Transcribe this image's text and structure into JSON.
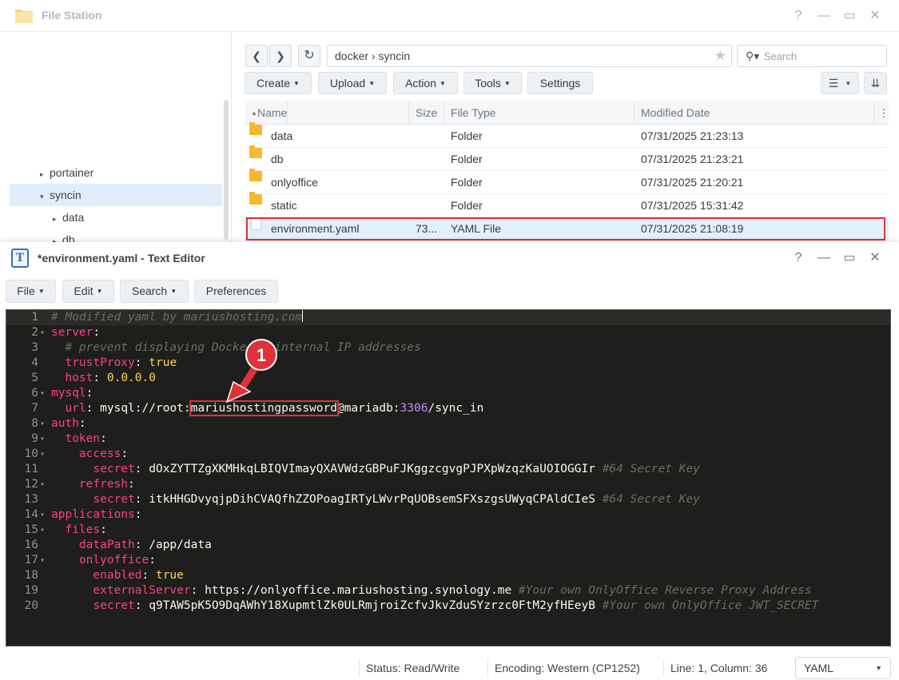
{
  "file_station": {
    "title": "File Station",
    "window_controls": [
      "?",
      "—",
      "▭",
      "✕"
    ],
    "tree": [
      {
        "label": "portainer",
        "arrow": "▸"
      },
      {
        "label": "syncin",
        "arrow": "▾",
        "selected": true
      },
      {
        "label": "data",
        "arrow": "▸"
      },
      {
        "label": "db",
        "arrow": "▸"
      }
    ],
    "nav": {
      "back": "❮",
      "forward": "❯",
      "refresh": "↻"
    },
    "path": {
      "parts": [
        "docker",
        "syncin"
      ],
      "separator": "›",
      "text": "docker › syncin"
    },
    "search_placeholder": "Search",
    "toolbar": {
      "create": "Create",
      "upload": "Upload",
      "action": "Action",
      "tools": "Tools",
      "settings": "Settings"
    },
    "columns": [
      "Name",
      "Size",
      "File Type",
      "Modified Date"
    ],
    "sort_indicator": "▲",
    "rows": [
      {
        "name": "data",
        "size": "",
        "type": "Folder",
        "modified": "07/31/2025 21:23:13",
        "icon": "folder-icon"
      },
      {
        "name": "db",
        "size": "",
        "type": "Folder",
        "modified": "07/31/2025 21:23:21",
        "icon": "folder-icon"
      },
      {
        "name": "onlyoffice",
        "size": "",
        "type": "Folder",
        "modified": "07/31/2025 21:20:21",
        "icon": "folder-icon"
      },
      {
        "name": "static",
        "size": "",
        "type": "Folder",
        "modified": "07/31/2025 15:31:42",
        "icon": "folder-icon"
      },
      {
        "name": "environment.yaml",
        "size": "73...",
        "type": "YAML File",
        "modified": "07/31/2025 21:08:19",
        "icon": "file-icon",
        "selected": true
      }
    ]
  },
  "text_editor": {
    "title": "*environment.yaml - Text Editor",
    "menus": {
      "file": "File",
      "edit": "Edit",
      "search": "Search",
      "preferences": "Preferences"
    },
    "annotation_number": "1",
    "lines": [
      {
        "n": "1",
        "fold": "",
        "segs": [
          {
            "t": "# Modified yaml by mariushosting.com",
            "c": "comment"
          }
        ]
      },
      {
        "n": "2",
        "fold": "▾",
        "segs": [
          {
            "t": "server",
            "c": "key"
          },
          {
            "t": ":",
            "c": "punct"
          }
        ]
      },
      {
        "n": "3",
        "fold": "",
        "segs": [
          {
            "t": "  ",
            "c": "plain"
          },
          {
            "t": "# prevent displaying Docker's internal IP addresses",
            "c": "comment"
          }
        ]
      },
      {
        "n": "4",
        "fold": "",
        "segs": [
          {
            "t": "  ",
            "c": "plain"
          },
          {
            "t": "trustProxy",
            "c": "key"
          },
          {
            "t": ": ",
            "c": "punct"
          },
          {
            "t": "true",
            "c": "bool"
          }
        ]
      },
      {
        "n": "5",
        "fold": "",
        "segs": [
          {
            "t": "  ",
            "c": "plain"
          },
          {
            "t": "host",
            "c": "key"
          },
          {
            "t": ": ",
            "c": "punct"
          },
          {
            "t": "0.0.0.0",
            "c": "bool"
          }
        ]
      },
      {
        "n": "6",
        "fold": "▾",
        "segs": [
          {
            "t": "mysql",
            "c": "key"
          },
          {
            "t": ":",
            "c": "punct"
          }
        ]
      },
      {
        "n": "7",
        "fold": "",
        "segs": [
          {
            "t": "  ",
            "c": "plain"
          },
          {
            "t": "url",
            "c": "key"
          },
          {
            "t": ": ",
            "c": "punct"
          },
          {
            "t": "mysql://root:",
            "c": "plain"
          },
          {
            "t": "mariushostingpassword",
            "c": "password"
          },
          {
            "t": "@mariadb:",
            "c": "plain"
          },
          {
            "t": "3306",
            "c": "num"
          },
          {
            "t": "/sync_in",
            "c": "plain"
          }
        ]
      },
      {
        "n": "8",
        "fold": "▾",
        "segs": [
          {
            "t": "auth",
            "c": "key"
          },
          {
            "t": ":",
            "c": "punct"
          }
        ]
      },
      {
        "n": "9",
        "fold": "▾",
        "segs": [
          {
            "t": "  ",
            "c": "plain"
          },
          {
            "t": "token",
            "c": "key"
          },
          {
            "t": ":",
            "c": "punct"
          }
        ]
      },
      {
        "n": "10",
        "fold": "▾",
        "segs": [
          {
            "t": "    ",
            "c": "plain"
          },
          {
            "t": "access",
            "c": "key"
          },
          {
            "t": ":",
            "c": "punct"
          }
        ]
      },
      {
        "n": "11",
        "fold": "",
        "segs": [
          {
            "t": "      ",
            "c": "plain"
          },
          {
            "t": "secret",
            "c": "key"
          },
          {
            "t": ": ",
            "c": "punct"
          },
          {
            "t": "dOxZYTTZgXKMHkqLBIQVImayQXAVWdzGBPuFJKggzcgvgPJPXpWzqzKaUOIOGGIr ",
            "c": "plain"
          },
          {
            "t": "#64 Secret Key",
            "c": "comment"
          }
        ]
      },
      {
        "n": "12",
        "fold": "▾",
        "segs": [
          {
            "t": "    ",
            "c": "plain"
          },
          {
            "t": "refresh",
            "c": "key"
          },
          {
            "t": ":",
            "c": "punct"
          }
        ]
      },
      {
        "n": "13",
        "fold": "",
        "segs": [
          {
            "t": "      ",
            "c": "plain"
          },
          {
            "t": "secret",
            "c": "key"
          },
          {
            "t": ": ",
            "c": "punct"
          },
          {
            "t": "itkHHGDvyqjpDihCVAQfhZZOPoagIRTyLWvrPqUOBsemSFXszgsUWyqCPAldCIeS ",
            "c": "plain"
          },
          {
            "t": "#64 Secret Key",
            "c": "comment"
          }
        ]
      },
      {
        "n": "14",
        "fold": "▾",
        "segs": [
          {
            "t": "applications",
            "c": "key"
          },
          {
            "t": ":",
            "c": "punct"
          }
        ]
      },
      {
        "n": "15",
        "fold": "▾",
        "segs": [
          {
            "t": "  ",
            "c": "plain"
          },
          {
            "t": "files",
            "c": "key"
          },
          {
            "t": ":",
            "c": "punct"
          }
        ]
      },
      {
        "n": "16",
        "fold": "",
        "segs": [
          {
            "t": "    ",
            "c": "plain"
          },
          {
            "t": "dataPath",
            "c": "key"
          },
          {
            "t": ": ",
            "c": "punct"
          },
          {
            "t": "/app/data",
            "c": "plain"
          }
        ]
      },
      {
        "n": "17",
        "fold": "▾",
        "segs": [
          {
            "t": "    ",
            "c": "plain"
          },
          {
            "t": "onlyoffice",
            "c": "key"
          },
          {
            "t": ":",
            "c": "punct"
          }
        ]
      },
      {
        "n": "18",
        "fold": "",
        "segs": [
          {
            "t": "      ",
            "c": "plain"
          },
          {
            "t": "enabled",
            "c": "key"
          },
          {
            "t": ": ",
            "c": "punct"
          },
          {
            "t": "true",
            "c": "bool"
          }
        ]
      },
      {
        "n": "19",
        "fold": "",
        "segs": [
          {
            "t": "      ",
            "c": "plain"
          },
          {
            "t": "externalServer",
            "c": "key"
          },
          {
            "t": ": ",
            "c": "punct"
          },
          {
            "t": "https://onlyoffice.mariushosting.synology.me ",
            "c": "plain"
          },
          {
            "t": "#Your own OnlyOffice Reverse Proxy Address",
            "c": "comment"
          }
        ]
      },
      {
        "n": "20",
        "fold": "",
        "segs": [
          {
            "t": "      ",
            "c": "plain"
          },
          {
            "t": "secret",
            "c": "key"
          },
          {
            "t": ": ",
            "c": "punct"
          },
          {
            "t": "q9TAW5pK5O9DqAWhY18XupmtlZk0ULRmjroiZcfvJkvZduSYzrzc0FtM2yfHEeyB ",
            "c": "plain"
          },
          {
            "t": "#Your own OnlyOffice JWT_SECRET",
            "c": "comment"
          }
        ]
      }
    ],
    "status": {
      "mode": "Status: Read/Write",
      "encoding": "Encoding: Western (CP1252)",
      "position": "Line: 1, Column: 36",
      "language": "YAML"
    }
  },
  "colors": {
    "editor_bg": "#1e1f1c",
    "key": "#ff3f8a",
    "bool": "#ffd452",
    "number": "#c38bff",
    "comment": "#6a6c63",
    "highlight": "#e0313b",
    "folder": "#f5b82e"
  }
}
